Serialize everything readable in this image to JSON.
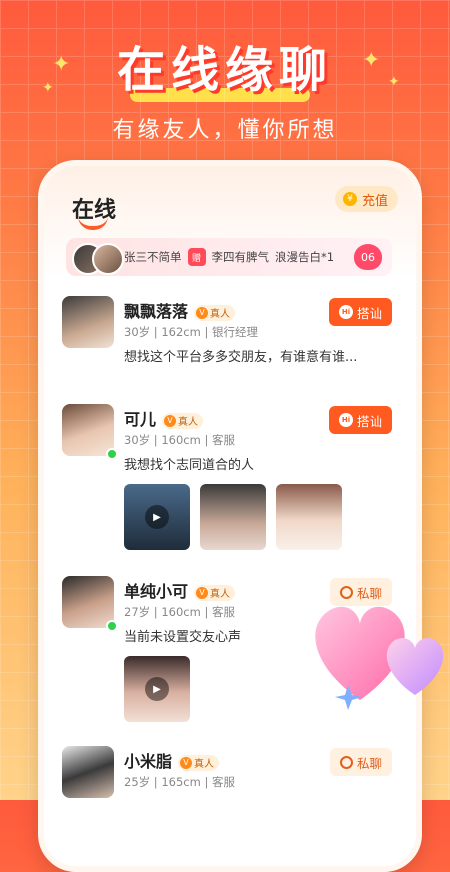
{
  "hero": {
    "title": "在线缘聊",
    "subtitle": "有缘友人，懂你所想"
  },
  "header": {
    "brand": "在线",
    "recharge_label": "充值"
  },
  "ticker": {
    "text1": "张三不简单",
    "gift_label": "赠",
    "text2": "李四有脾气",
    "text3": "浪漫告白*1",
    "count": "06"
  },
  "users": [
    {
      "name": "飘飘落落",
      "verified": "真人",
      "age": "30岁",
      "height": "162cm",
      "job": "银行经理",
      "message": "想找这个平台多多交朋友，有谁意有谁...",
      "action": "搭讪",
      "online": false
    },
    {
      "name": "可儿",
      "verified": "真人",
      "age": "30岁",
      "height": "160cm",
      "job": "客服",
      "message": "我想找个志同道合的人",
      "action": "搭讪",
      "online": true
    },
    {
      "name": "单纯小可",
      "verified": "真人",
      "age": "27岁",
      "height": "160cm",
      "job": "客服",
      "message": "当前未设置交友心声",
      "action": "私聊",
      "online": true
    },
    {
      "name": "小米脂",
      "verified": "真人",
      "age": "25岁",
      "height": "165cm",
      "job": "客服",
      "message": "",
      "action": "私聊",
      "online": false
    }
  ],
  "separator": "|",
  "colors": {
    "accent": "#ff5a1f",
    "online": "#2fd14a"
  },
  "icons": [
    "sparkle-icon",
    "coin-icon",
    "gift-icon",
    "heart-icon",
    "hi-icon",
    "chat-icon",
    "verified-icon",
    "play-icon"
  ]
}
